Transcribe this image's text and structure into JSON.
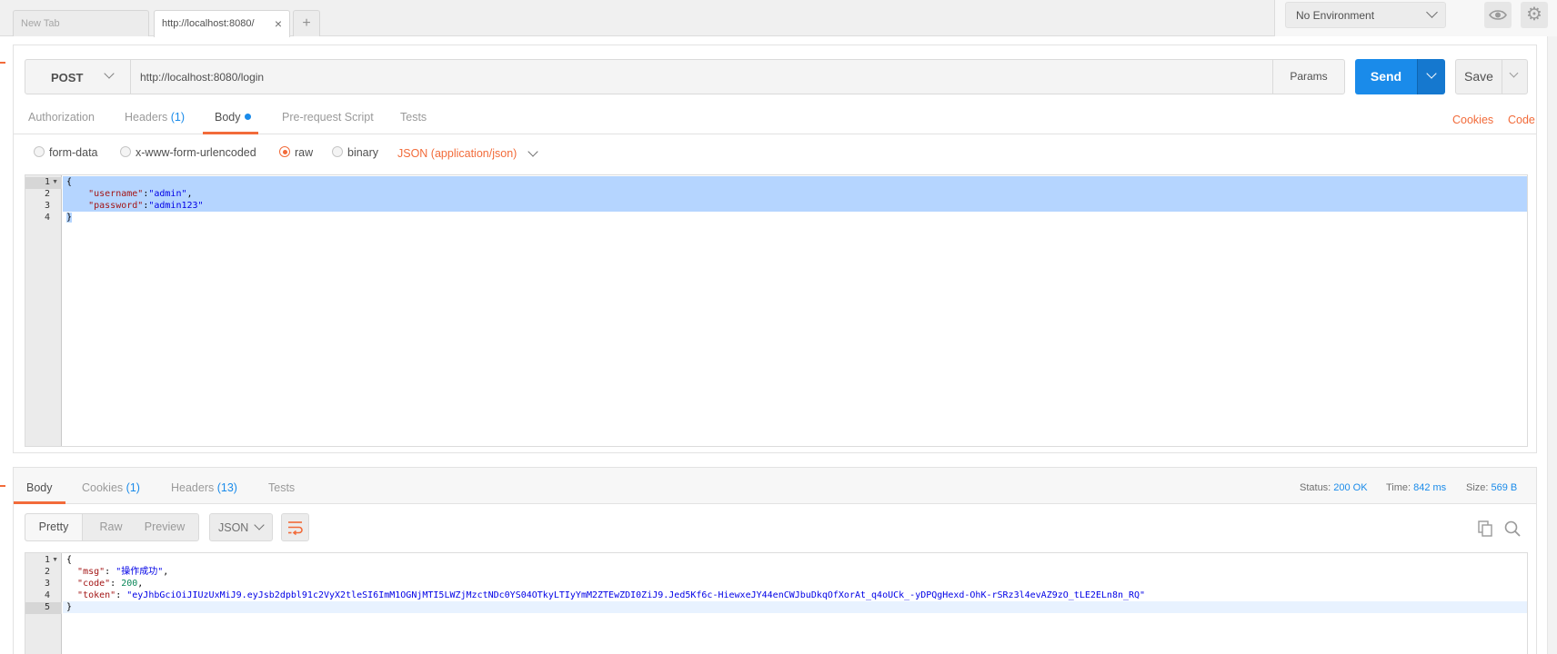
{
  "tabs": {
    "new_tab_label": "New Tab",
    "active_tab_label": "http://localhost:8080/",
    "close_glyph": "×",
    "add_glyph": "+"
  },
  "environment": {
    "selected": "No Environment"
  },
  "icons": {
    "gear": "⚙"
  },
  "request": {
    "method": "POST",
    "url": "http://localhost:8080/login",
    "params_label": "Params",
    "send_label": "Send",
    "save_label": "Save",
    "tabs": [
      {
        "label": "Authorization"
      },
      {
        "label": "Headers",
        "count": "(1)"
      },
      {
        "label": "Body"
      },
      {
        "label": "Pre-request Script"
      },
      {
        "label": "Tests"
      }
    ],
    "cookies_link": "Cookies",
    "code_link": "Code",
    "body_types": [
      "form-data",
      "x-www-form-urlencoded",
      "raw",
      "binary"
    ],
    "selected_body_type": "raw",
    "content_type": "JSON (application/json)",
    "body_lines": [
      "1",
      "2",
      "3",
      "4"
    ],
    "body": {
      "open": "{",
      "k1": "\"username\"",
      "v1": "\"admin\"",
      "k2": "\"password\"",
      "v2": "\"admin123\"",
      "close": "}"
    }
  },
  "response": {
    "tabs": [
      {
        "label": "Body"
      },
      {
        "label": "Cookies",
        "count": "(1)"
      },
      {
        "label": "Headers",
        "count": "(13)"
      },
      {
        "label": "Tests"
      }
    ],
    "status_label": "Status:",
    "status_value": "200 OK",
    "time_label": "Time:",
    "time_value": "842 ms",
    "size_label": "Size:",
    "size_value": "569 B",
    "view_modes": [
      "Pretty",
      "Raw",
      "Preview"
    ],
    "format": "JSON",
    "body_lines": [
      "1",
      "2",
      "3",
      "4",
      "5"
    ],
    "body": {
      "open": "{",
      "k_msg": "\"msg\"",
      "v_msg": "\"操作成功\"",
      "k_code": "\"code\"",
      "v_code": "200",
      "k_token": "\"token\"",
      "v_token": "\"eyJhbGciOiJIUzUxMiJ9.eyJsb2dpbl91c2VyX2tleSI6ImM1OGNjMTI5LWZjMzctNDc0YS04OTkyLTIyYmM2ZTEwZDI0ZiJ9.Jed5Kf6c-HiewxeJY44enCWJbuDkqOfXorAt_q4oUCk_-yDPQgHexd-OhK-rSRz3l4evAZ9zO_tLE2ELn8n_RQ\"",
      "close": "}"
    }
  },
  "colors": {
    "accent": "#f26b3a",
    "send": "#1a8bea",
    "selection": "#b5d5ff"
  }
}
